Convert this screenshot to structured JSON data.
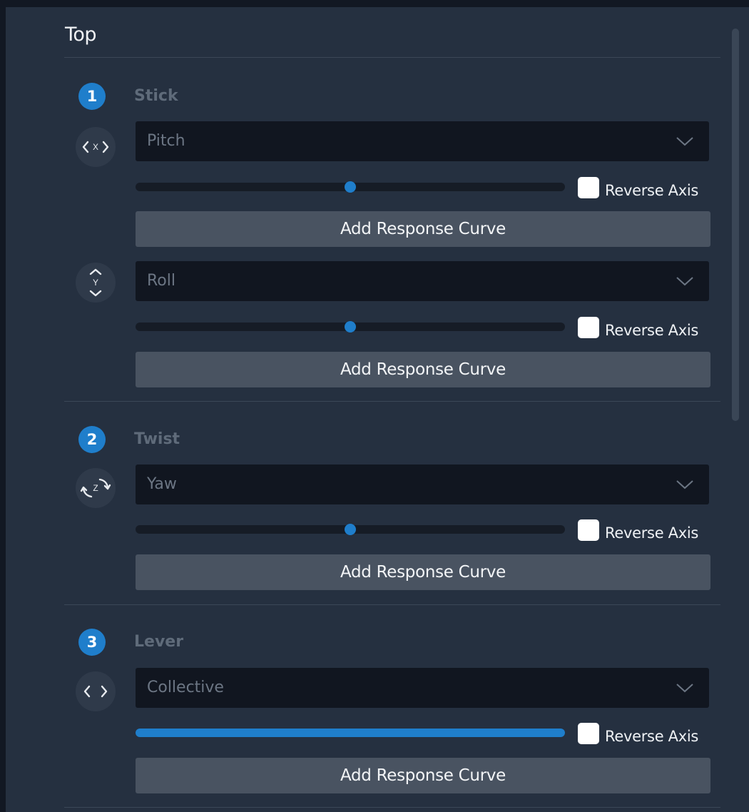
{
  "section": {
    "title": "Top"
  },
  "groups": [
    {
      "number": "1",
      "label": "Stick",
      "axes": [
        {
          "icon": "axis-x-icon",
          "icon_letter": "X",
          "selected": "Pitch",
          "slider_value": 0.5,
          "reverse_label": "Reverse Axis",
          "reverse_checked": false,
          "curve_button": "Add Response Curve"
        },
        {
          "icon": "axis-y-icon",
          "icon_letter": "Y",
          "selected": "Roll",
          "slider_value": 0.5,
          "reverse_label": "Reverse Axis",
          "reverse_checked": false,
          "curve_button": "Add Response Curve"
        }
      ]
    },
    {
      "number": "2",
      "label": "Twist",
      "axes": [
        {
          "icon": "axis-z-rotate-icon",
          "icon_letter": "Z",
          "selected": "Yaw",
          "slider_value": 0.5,
          "reverse_label": "Reverse Axis",
          "reverse_checked": false,
          "curve_button": "Add Response Curve"
        }
      ]
    },
    {
      "number": "3",
      "label": "Lever",
      "axes": [
        {
          "icon": "axis-lever-icon",
          "icon_letter": "",
          "selected": "Collective",
          "slider_value": 1.0,
          "reverse_label": "Reverse Axis",
          "reverse_checked": false,
          "curve_button": "Add Response Curve"
        }
      ]
    }
  ],
  "colors": {
    "accent": "#1f7ecb",
    "panel": "#253040",
    "dropdown": "#111620",
    "button": "#495361"
  }
}
